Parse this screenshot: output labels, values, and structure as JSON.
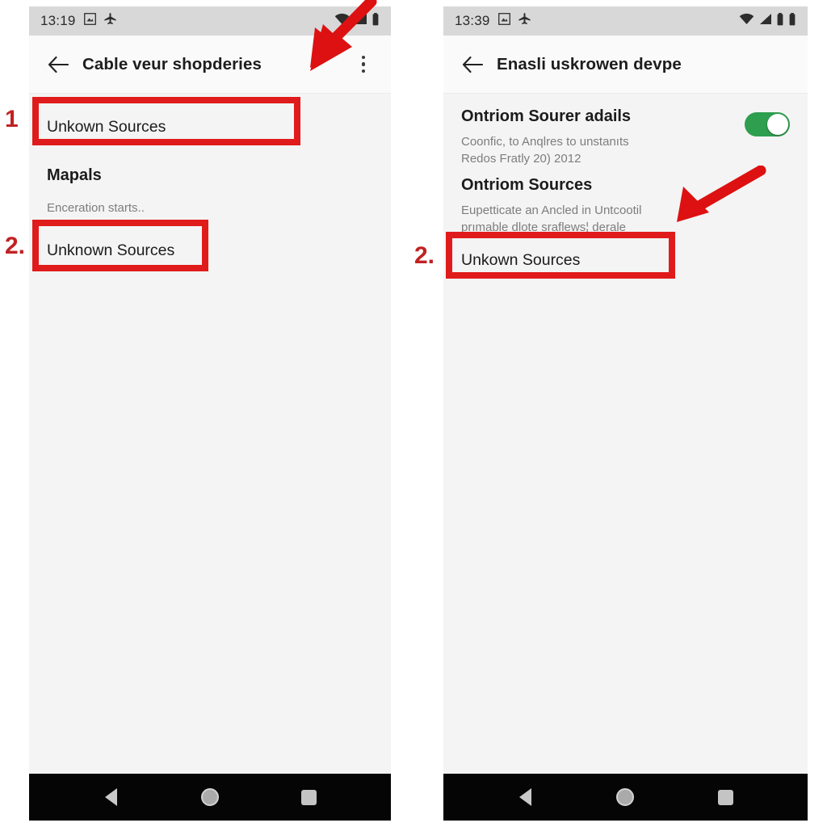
{
  "panels": [
    {
      "id": "left",
      "status": {
        "clock": "13:19",
        "icons": [
          "screenshot-icon",
          "airplane-mode-icon"
        ],
        "right_icons": [
          "wifi-icon",
          "cell-signal-icon",
          "battery-icon"
        ]
      },
      "appbar": {
        "back": "back-arrow-icon",
        "title": "Cable veur shopderies",
        "overflow": "overflow-menu-icon"
      },
      "rows": [
        {
          "title": "Unkown Sources",
          "sub": ""
        },
        {
          "title": "Mapals",
          "sub": "Enceration starts.."
        },
        {
          "title": "Unknown Sources",
          "sub": ""
        }
      ],
      "nav": [
        "back-nav-icon",
        "home-nav-icon",
        "recents-nav-icon"
      ]
    },
    {
      "id": "right",
      "status": {
        "clock": "13:39",
        "icons": [
          "screenshot-icon",
          "airplane-mode-icon"
        ],
        "right_icons": [
          "wifi-icon",
          "cell-signal-icon",
          "battery-icon",
          "battery-icon"
        ]
      },
      "appbar": {
        "back": "back-arrow-icon",
        "title": "Enasli uskrowen devpe",
        "overflow": ""
      },
      "rows": [
        {
          "title": "Ontriom Sourer adails",
          "sub_line1": "Coonfic, to Anqlres to unstanıts",
          "sub_line2": "Redos Fratly 20) 2012",
          "toggle": {
            "state": "on",
            "color": "#2e9e4f"
          }
        },
        {
          "title": "Ontriom Sources",
          "sub_line1": "Eupetticate an Ancled in Untcootil",
          "sub_line2": "prımable dlote sraflews¦ derale"
        },
        {
          "title": "Unkown Sources",
          "sub": ""
        }
      ],
      "nav": [
        "back-nav-icon",
        "home-nav-icon",
        "recents-nav-icon"
      ]
    }
  ],
  "annotations": {
    "marker_color": "#c12222",
    "box_color": "#e01b1b",
    "arrow_color": "#dd1111",
    "left": {
      "step1_label": "1",
      "step2_label": "2.",
      "arrow": "down-left-arrow-icon"
    },
    "right": {
      "step2_label": "2.",
      "arrow": "down-left-arrow-icon"
    }
  }
}
